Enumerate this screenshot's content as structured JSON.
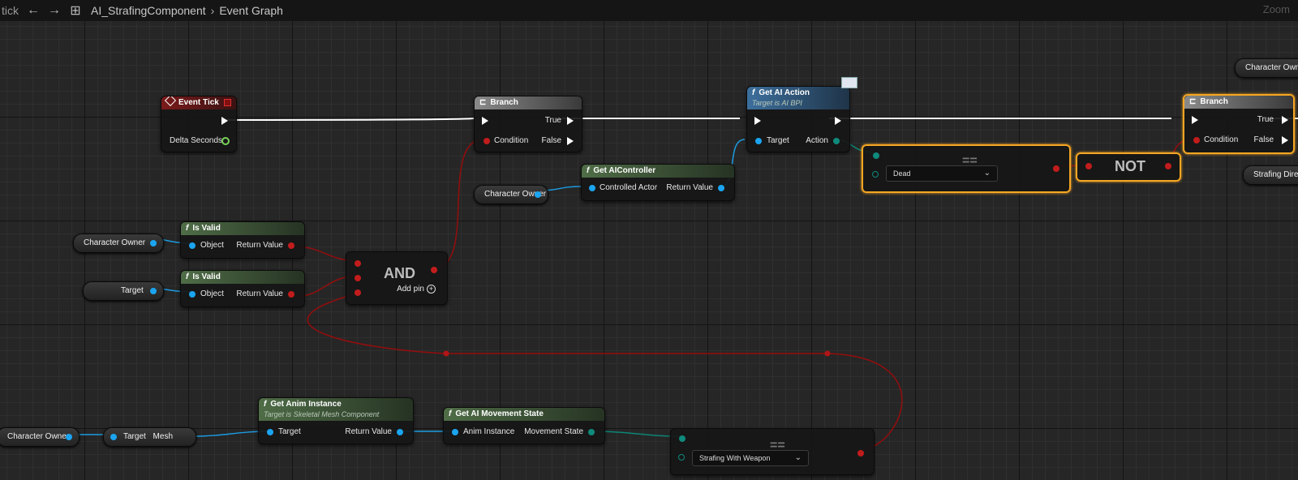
{
  "toolbar": {
    "partial_tab": "tick",
    "back_icon": "back-arrow-icon",
    "forward_icon": "forward-arrow-icon",
    "graph_icon": "graph-hierarchy-icon",
    "breadcrumb": [
      "AI_StrafingComponent",
      "Event Graph"
    ],
    "zoom_label": "Zoom"
  },
  "nodes": {
    "event_tick": {
      "title": "Event Tick",
      "delta": "Delta Seconds"
    },
    "branch1": {
      "title": "Branch",
      "condition": "Condition",
      "true_label": "True",
      "false_label": "False"
    },
    "get_ai_action": {
      "title": "Get AI Action",
      "subtitle": "Target is AI BPI",
      "target": "Target",
      "action": "Action"
    },
    "get_ai_controller": {
      "title": "Get AIController",
      "input": "Controlled Actor",
      "output": "Return Value"
    },
    "is_valid_1": {
      "title": "Is Valid",
      "input": "Object",
      "output": "Return Value"
    },
    "is_valid_2": {
      "title": "Is Valid",
      "input": "Object",
      "output": "Return Value"
    },
    "and_node": {
      "title": "AND",
      "add_pin": "Add pin"
    },
    "equal_dead": {
      "title": "==",
      "dropdown": "Dead"
    },
    "not_node": {
      "title": "NOT"
    },
    "branch2": {
      "title": "Branch",
      "condition": "Condition",
      "true_label": "True",
      "false_label": "False"
    },
    "get_anim_instance": {
      "title": "Get Anim Instance",
      "subtitle": "Target is Skeletal Mesh Component",
      "target": "Target",
      "output": "Return Value"
    },
    "get_movement_state": {
      "title": "Get AI Movement State",
      "input": "Anim Instance",
      "output": "Movement State"
    },
    "equal_strafing": {
      "title": "==",
      "dropdown": "Strafing With Weapon"
    },
    "mesh_getter": {
      "target": "Target",
      "mesh": "Mesh"
    }
  },
  "variables": {
    "character_owner_top": "Character Owner",
    "character_owner_left": "Character Owner",
    "target": "Target",
    "character_owner_bottom": "Character Owner",
    "character_owner_far_right": "Character Owne",
    "strafing_direction": "Strafing Direc"
  },
  "colors": {
    "exec_wire": "#ffffff",
    "bool_wire": "#950d0d",
    "object_wire": "#1b9be0",
    "struct_wire": "#0d8576",
    "selection": "#f5a623"
  }
}
